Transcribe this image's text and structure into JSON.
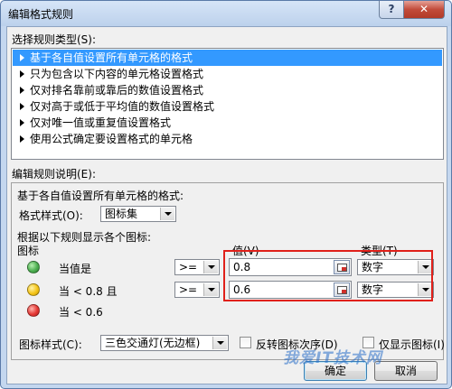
{
  "window": {
    "title": "编辑格式规则",
    "help_label": "?",
    "close_label": "✕"
  },
  "rule_type": {
    "label": "选择规则类型(S):",
    "items": [
      {
        "label": "基于各自值设置所有单元格的格式",
        "selected": true
      },
      {
        "label": "只为包含以下内容的单元格设置格式",
        "selected": false
      },
      {
        "label": "仅对排名靠前或靠后的数值设置格式",
        "selected": false
      },
      {
        "label": "仅对高于或低于平均值的数值设置格式",
        "selected": false
      },
      {
        "label": "仅对唯一值或重复值设置格式",
        "selected": false
      },
      {
        "label": "使用公式确定要设置格式的单元格",
        "selected": false
      }
    ]
  },
  "rule_desc": {
    "label": "编辑规则说明(E):",
    "subtitle": "基于各自值设置所有单元格的格式:",
    "format_style_label": "格式样式(O):",
    "format_style_value": "图标集",
    "rule_caption": "根据以下规则显示各个图标:",
    "icon_header": "图标",
    "value_header": "值(V)",
    "type_header": "类型(T)",
    "rows": [
      {
        "color": "#4caf50",
        "text": "当值是",
        "operator": ">=",
        "value": "0.8",
        "type": "数字"
      },
      {
        "color": "#f5c518",
        "text": "当 < 0.8 且",
        "operator": ">=",
        "value": "0.6",
        "type": "数字"
      },
      {
        "color": "#e53935",
        "text": "当 < 0.6"
      }
    ],
    "icon_style_label": "图标样式(C):",
    "icon_style_value": "三色交通灯(无边框)",
    "reverse_label": "反转图标次序(D)",
    "show_icon_only_label": "仅显示图标(I)"
  },
  "buttons": {
    "ok": "确定",
    "cancel": "取消"
  },
  "watermark": "我爱IT技术网"
}
